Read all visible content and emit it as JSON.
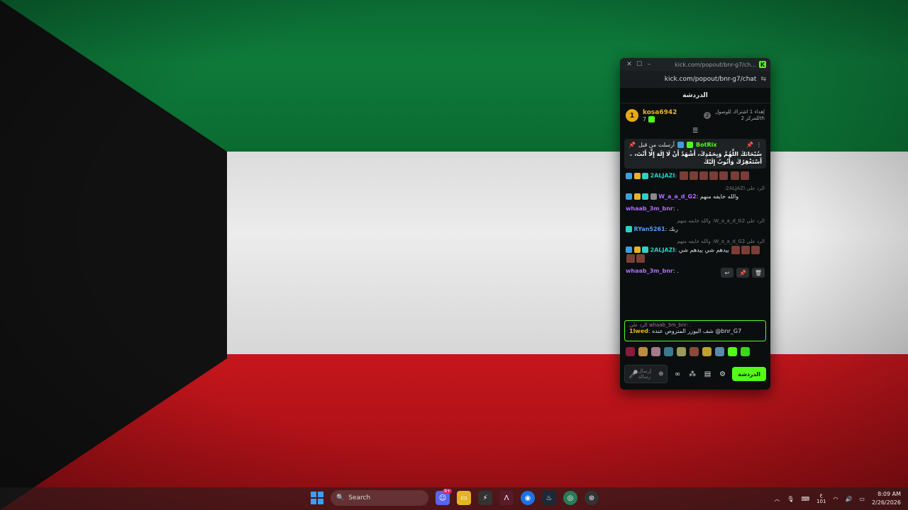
{
  "window": {
    "title": "kick.com/popout/bnr-g7/ch...",
    "url": "kick.com/popout/bnr-g7/chat",
    "header": "الدردشة"
  },
  "top_gifter": {
    "rank": "1",
    "name": "kosa6942",
    "count": "7",
    "info_line1": "إهداء 1 اشتراك للوصول",
    "info_line2": "للمركز 2th",
    "info_rank": "2"
  },
  "pinned": {
    "label": "أرسلت من قبل",
    "user": "BotRix",
    "text": "سُبْحَانَكَ اللَّهُمَّ وَبِحَمْدِكَ، أَشْهَدُ أَنْ لَا إِلَهَ إِلَّا أَنْتَ، أَسْتَغْفِرُكَ وَأَتُوبُ إِلَيْكَ"
  },
  "messages": [
    {
      "reply": "",
      "user": "2ALJAZI",
      "text": ""
    },
    {
      "reply": "الرد على 2ALJAZI:",
      "user": "W_a_a_d_G2",
      "text": "والله خايفه منهم"
    },
    {
      "reply": "",
      "user": "whaab_3m_bnr",
      "text": "."
    },
    {
      "reply": "الرد على W_a_a_d_G2: والله خايفه منهم",
      "user": "RYan5261",
      "text": "ربك"
    },
    {
      "reply": "الرد على W_a_a_d_G2: والله خايفه منهم",
      "user": "2ALJAZI",
      "text": "بيدهم شي بيدهم شي"
    },
    {
      "reply": "",
      "user": "whaab_3m_bnr",
      "text": "."
    }
  ],
  "reply_box": {
    "reply_to": "الرد على whaab_3m_bnr: .",
    "user": "1lwed",
    "text": "شف اليوزر المتروص عنده @bnr_G7"
  },
  "input": {
    "placeholder": "إرسال رسالة"
  },
  "send_label": "الدردشة",
  "taskbar": {
    "search_label": "Search",
    "discord_badge": "9+",
    "time": "8:09 AM",
    "date": "2/26/2026",
    "lang_top": "ع",
    "lang_bottom": "101"
  },
  "colors": {
    "kick_green": "#53fc18",
    "flag_green": "#0e7a3a",
    "flag_red": "#b01218",
    "flag_black": "#111111"
  }
}
